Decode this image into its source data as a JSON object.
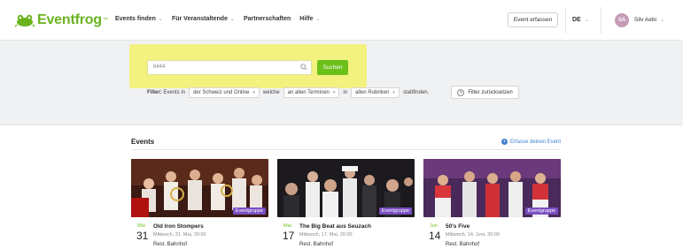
{
  "header": {
    "logo_text": "Eventfrog",
    "logo_tm": "™",
    "nav": [
      {
        "label": "Events finden",
        "chevron": "⌄"
      },
      {
        "label": "Für Veranstaltende",
        "chevron": "⌄"
      },
      {
        "label": "Partnerschaften",
        "chevron": ""
      },
      {
        "label": "Hilfe",
        "chevron": "⌄"
      }
    ],
    "create_button": "Event erfassen",
    "language": "DE",
    "user_initials": "SA",
    "user_name": "Silv Aebi",
    "brand_color": "#6ab31f"
  },
  "search": {
    "input_value": "6444",
    "button_label": "Suchen",
    "highlight_color": "#f3f16a",
    "button_color": "#6cc01a"
  },
  "filter": {
    "label": "Filter:",
    "text_events_in": "Events in",
    "location": "der Schweiz und Online",
    "text_which": "welche",
    "dates": "an allen Terminen",
    "text_in": "in",
    "categories": "allen Rubriken",
    "text_end": "stattfinden.",
    "reset_label": "Filter zurücksetzen"
  },
  "events": {
    "title": "Events",
    "create_link": "Erfasse deinen Event",
    "badge_color": "#7a50c2",
    "cards": [
      {
        "month": "Mai",
        "day": "31",
        "title": "Old Iron Stompers",
        "datetime": "Mittwoch, 31. Mai, 20:00",
        "location": "Rest. Bahnhof",
        "badge": "Eventgruppe"
      },
      {
        "month": "Mai",
        "day": "17",
        "title": "The Big Beat aus Seuzach",
        "datetime": "Mittwoch, 17. Mai, 20:00",
        "location": "Rest. Bahnhof",
        "badge": "Eventgruppe"
      },
      {
        "month": "Jun",
        "day": "14",
        "title": "50's Five",
        "datetime": "Mittwoch, 14. Juni, 20:00",
        "location": "Rest. Bahnhof",
        "badge": "Eventgruppe"
      }
    ]
  }
}
